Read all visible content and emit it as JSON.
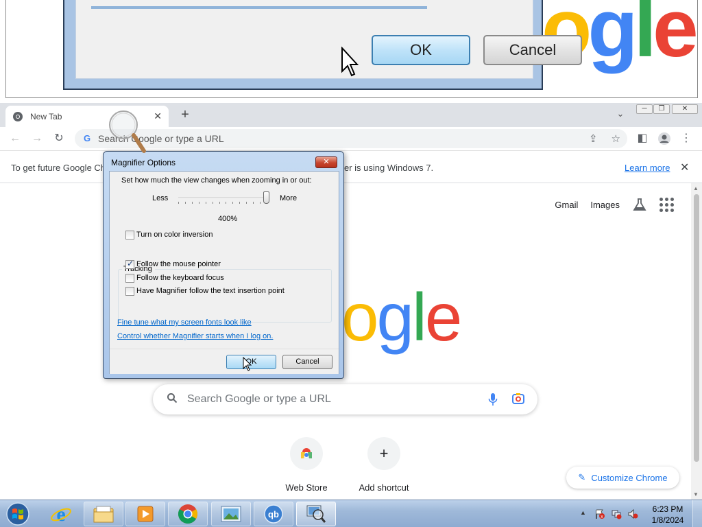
{
  "magnifier_view": {
    "ok_label": "OK",
    "cancel_label": "Cancel"
  },
  "chrome": {
    "tab_title": "New Tab",
    "omnibox_placeholder": "Search Google or type a URL",
    "infobar": {
      "message_part1": "To get future Google Ch",
      "message_part2": "er is using Windows 7.",
      "learn_more": "Learn more"
    },
    "ntp": {
      "gmail": "Gmail",
      "images": "Images",
      "search_placeholder": "Search Google or type a URL",
      "logo_letters": [
        "o",
        "g",
        "l",
        "e"
      ],
      "logo_colors": [
        "#fbbc05",
        "#4285f4",
        "#34a853",
        "#ea4335"
      ],
      "shortcuts": [
        {
          "label": "Web Store",
          "icon": "web-store-icon"
        },
        {
          "label": "Add shortcut",
          "icon": "plus-icon"
        }
      ],
      "customize": "Customize Chrome"
    }
  },
  "dialog": {
    "title": "Magnifier Options",
    "zoom_prompt": "Set how much the view changes when zooming in or out:",
    "less": "Less",
    "more": "More",
    "zoom_value": "400%",
    "zoom_level_fraction": 1.0,
    "color_inversion": {
      "label": "Turn on color inversion",
      "checked": false
    },
    "tracking_label": "Tracking",
    "tracking_options": [
      {
        "label": "Follow the mouse pointer",
        "checked": true
      },
      {
        "label": "Follow the keyboard focus",
        "checked": false
      },
      {
        "label": "Have Magnifier follow the text insertion point",
        "checked": false
      }
    ],
    "link_fonts": "Fine tune what my screen fonts look like",
    "link_startup": "Control whether Magnifier starts when I log on.",
    "ok": "OK",
    "cancel": "Cancel"
  },
  "taskbar": {
    "apps": [
      "internet-explorer-icon",
      "file-explorer-icon",
      "media-player-icon",
      "chrome-icon",
      "photo-viewer-icon",
      "qbittorrent-icon",
      "magnifier-icon"
    ],
    "qb_text": "qb",
    "time": "6:23 PM",
    "date": "1/8/2024"
  }
}
